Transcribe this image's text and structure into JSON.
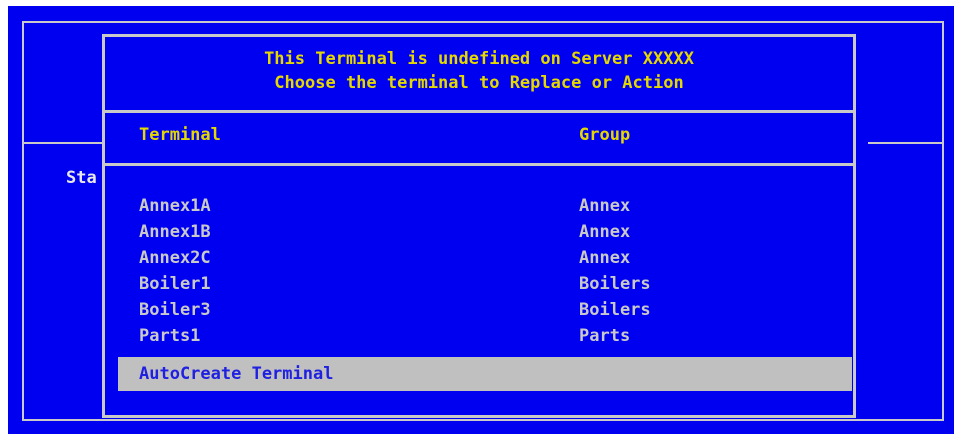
{
  "background": {
    "partial_label": "Sta"
  },
  "dialog": {
    "title_line1": "This Terminal is undefined on Server XXXXX",
    "title_line2": "Choose the terminal to Replace or Action",
    "columns": {
      "terminal": "Terminal",
      "group": "Group"
    },
    "rows": [
      {
        "terminal": "Annex1A",
        "group": "Annex"
      },
      {
        "terminal": "Annex1B",
        "group": "Annex"
      },
      {
        "terminal": "Annex2C",
        "group": "Annex"
      },
      {
        "terminal": "Boiler1",
        "group": "Boilers"
      },
      {
        "terminal": "Boiler3",
        "group": "Boilers"
      },
      {
        "terminal": "Parts1",
        "group": "Parts"
      }
    ],
    "selected_option": "AutoCreate Terminal"
  },
  "colors": {
    "background_blue": "#0000f0",
    "title_yellow": "#e4d800",
    "text_gray": "#c9c9c9",
    "highlight_gray": "#c0c0c0"
  }
}
